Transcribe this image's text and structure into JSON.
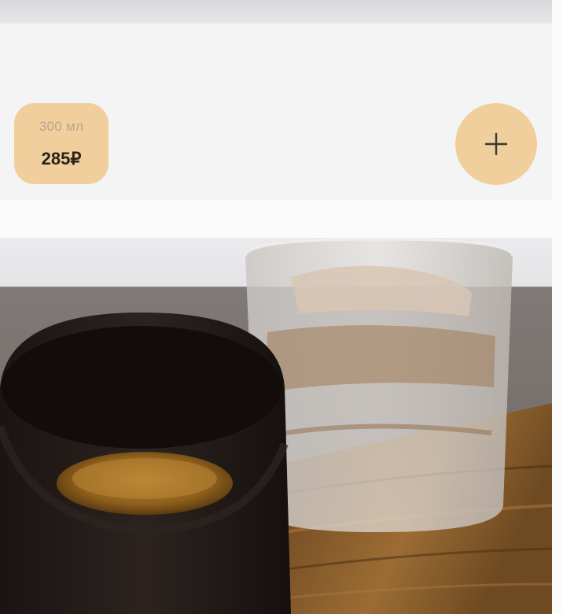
{
  "product_card": {
    "size_option": {
      "volume": "300 мл",
      "price": "285₽"
    },
    "add_button_icon": "plus-icon"
  },
  "next_product": {
    "image_icon": "espresso-photo"
  },
  "colors": {
    "accent": "#f0cf9d",
    "card_background": "#f4f4f4",
    "price_text": "#2a211b"
  }
}
